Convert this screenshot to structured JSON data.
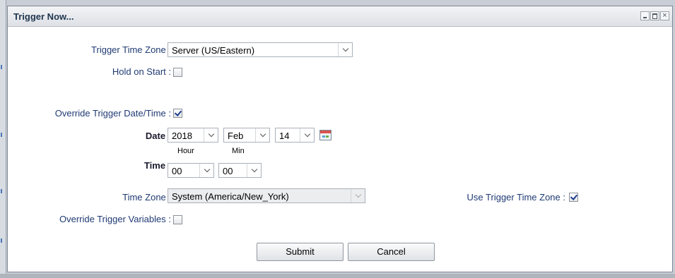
{
  "window": {
    "title": "Trigger Now..."
  },
  "form": {
    "trigger_time_zone": {
      "label": "Trigger Time Zone :",
      "value": "Server (US/Eastern)"
    },
    "hold_on_start": {
      "label": "Hold on Start :",
      "checked": false
    },
    "override_date_time": {
      "label": "Override Trigger Date/Time :",
      "checked": true
    },
    "date": {
      "label": "Date :",
      "year": "2018",
      "month": "Feb",
      "day": "14"
    },
    "time": {
      "label": "Time :",
      "hour_label": "Hour",
      "min_label": "Min",
      "hour": "00",
      "min": "00"
    },
    "time_zone": {
      "label": "Time Zone :",
      "value": "System (America/New_York)"
    },
    "use_trigger_time_zone": {
      "label": "Use Trigger Time Zone :",
      "checked": true
    },
    "override_variables": {
      "label": "Override Trigger Variables :",
      "checked": false
    }
  },
  "buttons": {
    "submit": "Submit",
    "cancel": "Cancel"
  },
  "icons": {
    "minimize": "minimize-icon",
    "maximize": "maximize-icon",
    "close": "close-icon",
    "calendar": "calendar-icon"
  }
}
